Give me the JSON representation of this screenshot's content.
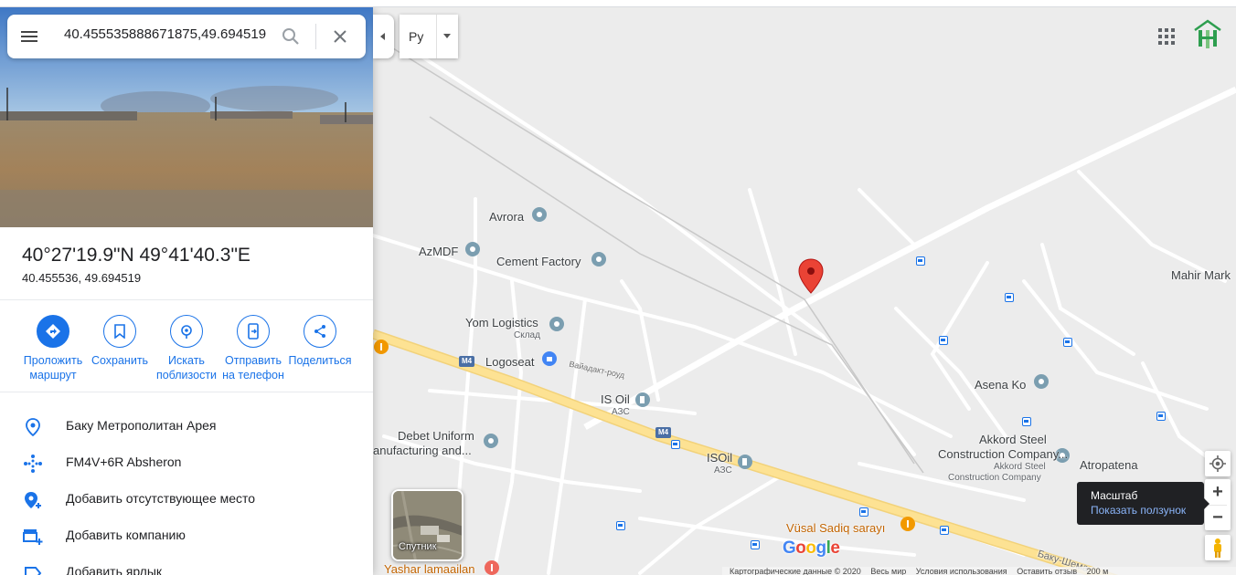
{
  "search": {
    "query": "40.455535888671875,49.694519"
  },
  "place": {
    "coords_dms": "40°27'19.9\"N 49°41'40.3\"E",
    "coords_decimal": "40.455536, 49.694519"
  },
  "actions": [
    {
      "label": "Проложить маршрут",
      "icon": "directions-icon"
    },
    {
      "label": "Сохранить",
      "icon": "bookmark-icon"
    },
    {
      "label": "Искать поблизости",
      "icon": "nearby-icon"
    },
    {
      "label": "Отправить на телефон",
      "icon": "send-to-phone-icon"
    },
    {
      "label": "Поделиться",
      "icon": "share-icon"
    }
  ],
  "info_rows": [
    {
      "text": "Баку Метрополитан Арея",
      "icon": "location-pin-icon"
    },
    {
      "text": "FM4V+6R Absheron",
      "icon": "plus-code-icon"
    },
    {
      "text": "Добавить отсутствующее место",
      "icon": "add-place-icon"
    },
    {
      "text": "Добавить компанию",
      "icon": "add-business-icon"
    },
    {
      "text": "Добавить ярлык",
      "icon": "label-icon"
    }
  ],
  "layer_toggle": {
    "label": "Ру"
  },
  "map_labels": {
    "avrora": "Avrora",
    "azmdf": "AzMDF",
    "cement": "Cement Factory",
    "yom": "Yom Logistics",
    "yom_sub": "Склад",
    "logoseat": "Logoseat",
    "viaduct": "Вайадакт-роуд",
    "isoil1": "IS Oil",
    "isoil1_sub": "АЗС",
    "isoil2": "ISOil",
    "isoil2_sub": "АЗС",
    "debet1": "Debet Uniform",
    "debet2": "anufacturing and...",
    "asena": "Asena Ko",
    "akkord1": "Akkord Steel",
    "akkord2": "Construction Company...",
    "akkord3": "Akkord Steel",
    "akkord4": "Construction Company",
    "atropatena": "Atropatena",
    "mahir": "Mahir Mark",
    "vusal": "Vüsal Sadiq sarayı",
    "baku_road": "Баку-Шема",
    "yesil": "Yashar lamaailan",
    "m4a": "M4",
    "m4b": "M4"
  },
  "satellite": {
    "label": "Спутник"
  },
  "google_logo": [
    "G",
    "o",
    "o",
    "g",
    "l",
    "e"
  ],
  "google_colors": [
    "#4285F4",
    "#EA4335",
    "#FBBC05",
    "#4285F4",
    "#34A853",
    "#EA4335"
  ],
  "tooltip": {
    "title": "Масштаб",
    "link": "Показать ползунок"
  },
  "footer": {
    "copyright": "Картографические данные © 2020",
    "world": "Весь мир",
    "terms": "Условия использования",
    "feedback": "Оставить отзыв",
    "scale": "200 м"
  },
  "colors": {
    "accent": "#1a73e8",
    "marker": "#ea4335",
    "highway": "#fde293",
    "poi": "#7b9eb0"
  }
}
